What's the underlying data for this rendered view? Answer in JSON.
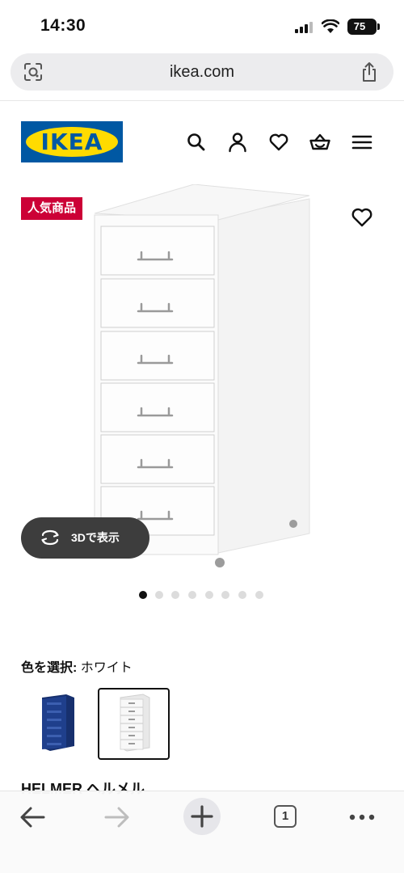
{
  "status_bar": {
    "time": "14:30",
    "battery": "75"
  },
  "browser": {
    "url": "ikea.com"
  },
  "header": {
    "logo_text": "IKEA",
    "icons": [
      "search-icon",
      "user-icon",
      "heart-icon",
      "basket-icon",
      "menu-icon"
    ]
  },
  "product": {
    "badge": "人気商品",
    "view_3d_label": "3Dで表示",
    "image_count": 8,
    "active_image_index": 0,
    "color_label": "色を選択:",
    "selected_color": "ホワイト",
    "color_options": [
      {
        "name": "blue",
        "hex": "#1f3f8c"
      },
      {
        "name": "white",
        "hex": "#f4f4f4"
      }
    ],
    "selected_color_index": 1,
    "name": "HELMER ヘルメル"
  },
  "toolbar": {
    "tab_count": "1",
    "icons": [
      "back-arrow-icon",
      "forward-arrow-icon",
      "new-tab-plus-icon",
      "tabs-icon",
      "more-icon"
    ]
  },
  "colors": {
    "ikea_blue": "#0058a3",
    "ikea_yellow": "#ffdb00",
    "badge_red": "#cc0036"
  }
}
